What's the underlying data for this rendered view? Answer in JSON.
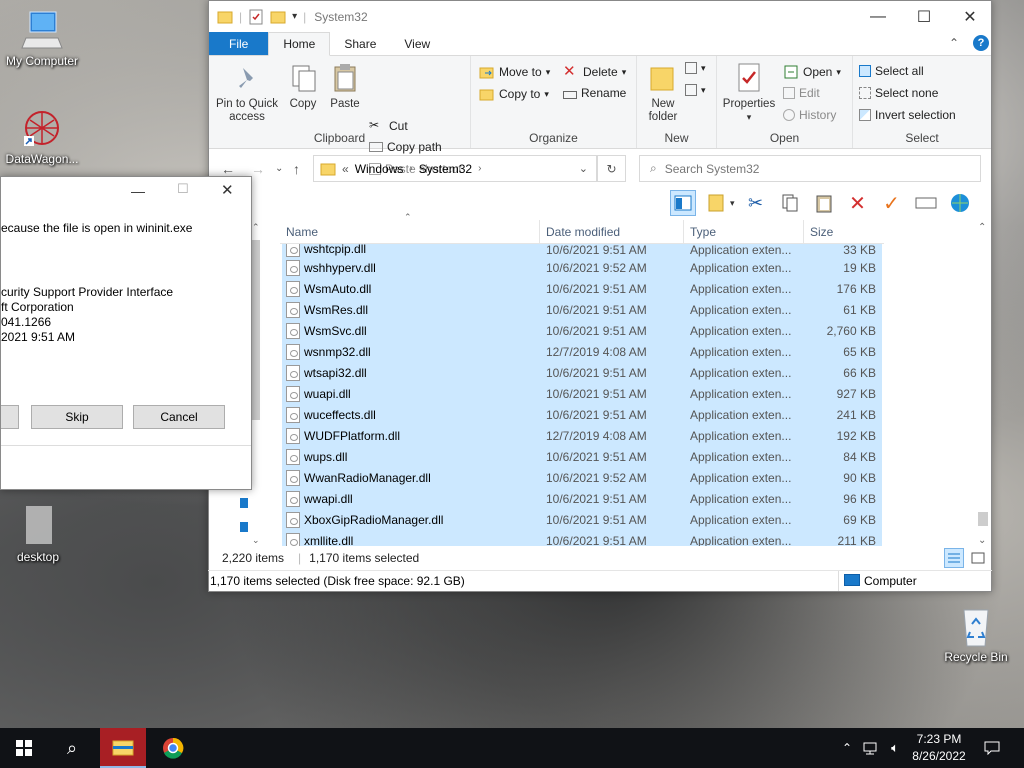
{
  "desktop": {
    "icons": [
      {
        "label": "My Computer",
        "icon": "computer-icon"
      },
      {
        "label": "DataWagon...",
        "icon": "datawagon-icon"
      },
      {
        "label": "desktop",
        "icon": "file-icon"
      },
      {
        "label": "Recycle Bin",
        "icon": "recycle-bin-icon"
      }
    ]
  },
  "explorer": {
    "title": "System32",
    "window_controls": {
      "minimize": "—",
      "maximize": "☐",
      "close": "✕"
    },
    "tabs": [
      "File",
      "Home",
      "Share",
      "View"
    ],
    "active_tab": "Home",
    "ribbon": {
      "clipboard": {
        "label": "Clipboard",
        "pin": "Pin to Quick access",
        "pin_line1": "Pin to Quick",
        "pin_line2": "access",
        "copy": "Copy",
        "paste": "Paste",
        "cut": "Cut",
        "copy_path": "Copy path",
        "paste_shortcut": "Paste shortcut"
      },
      "organize": {
        "label": "Organize",
        "move_to": "Move to",
        "copy_to": "Copy to",
        "delete": "Delete",
        "rename": "Rename"
      },
      "new": {
        "label": "New",
        "new_folder_line1": "New",
        "new_folder_line2": "folder"
      },
      "open": {
        "label": "Open",
        "properties": "Properties",
        "open": "Open",
        "edit": "Edit",
        "history": "History"
      },
      "select": {
        "label": "Select",
        "select_all": "Select all",
        "select_none": "Select none",
        "invert": "Invert selection"
      }
    },
    "address": {
      "prefix": "«",
      "crumbs": [
        "Windows",
        "System32"
      ],
      "search_placeholder": "Search System32"
    },
    "columns": [
      "Name",
      "Date modified",
      "Type",
      "Size"
    ],
    "partial_row": {
      "name": "wshtcpip.dll",
      "date": "10/6/2021 9:51 AM",
      "type": "Application exten...",
      "size": "33 KB"
    },
    "files": [
      {
        "name": "wshhyperv.dll",
        "date": "10/6/2021 9:52 AM",
        "type": "Application exten...",
        "size": "19 KB"
      },
      {
        "name": "WsmAuto.dll",
        "date": "10/6/2021 9:51 AM",
        "type": "Application exten...",
        "size": "176 KB"
      },
      {
        "name": "WsmRes.dll",
        "date": "10/6/2021 9:51 AM",
        "type": "Application exten...",
        "size": "61 KB"
      },
      {
        "name": "WsmSvc.dll",
        "date": "10/6/2021 9:51 AM",
        "type": "Application exten...",
        "size": "2,760 KB"
      },
      {
        "name": "wsnmp32.dll",
        "date": "12/7/2019 4:08 AM",
        "type": "Application exten...",
        "size": "65 KB"
      },
      {
        "name": "wtsapi32.dll",
        "date": "10/6/2021 9:51 AM",
        "type": "Application exten...",
        "size": "66 KB"
      },
      {
        "name": "wuapi.dll",
        "date": "10/6/2021 9:51 AM",
        "type": "Application exten...",
        "size": "927 KB"
      },
      {
        "name": "wuceffects.dll",
        "date": "10/6/2021 9:51 AM",
        "type": "Application exten...",
        "size": "241 KB"
      },
      {
        "name": "WUDFPlatform.dll",
        "date": "12/7/2019 4:08 AM",
        "type": "Application exten...",
        "size": "192 KB"
      },
      {
        "name": "wups.dll",
        "date": "10/6/2021 9:51 AM",
        "type": "Application exten...",
        "size": "84 KB"
      },
      {
        "name": "WwanRadioManager.dll",
        "date": "10/6/2021 9:52 AM",
        "type": "Application exten...",
        "size": "90 KB"
      },
      {
        "name": "wwapi.dll",
        "date": "10/6/2021 9:51 AM",
        "type": "Application exten...",
        "size": "96 KB"
      },
      {
        "name": "XboxGipRadioManager.dll",
        "date": "10/6/2021 9:51 AM",
        "type": "Application exten...",
        "size": "69 KB"
      },
      {
        "name": "xmllite.dll",
        "date": "10/6/2021 9:51 AM",
        "type": "Application exten...",
        "size": "211 KB"
      }
    ],
    "item_count": "2,220 items",
    "selected_count": "1,170 items selected",
    "statusbar_text": "1,170 items selected (Disk free space: 92.1 GB)",
    "statusbar_location": "Computer"
  },
  "dialog": {
    "line1": "ecause the file is open in wininit.exe",
    "line2": "curity Support Provider Interface",
    "line3": "ft Corporation",
    "line4": "041.1266",
    "line5": "2021 9:51 AM",
    "skip": "Skip",
    "cancel": "Cancel"
  },
  "taskbar": {
    "time": "7:23 PM",
    "date": "8/26/2022"
  },
  "colors": {
    "accent": "#1979ca",
    "selection": "#cce8ff",
    "taskbar": "#101216"
  }
}
